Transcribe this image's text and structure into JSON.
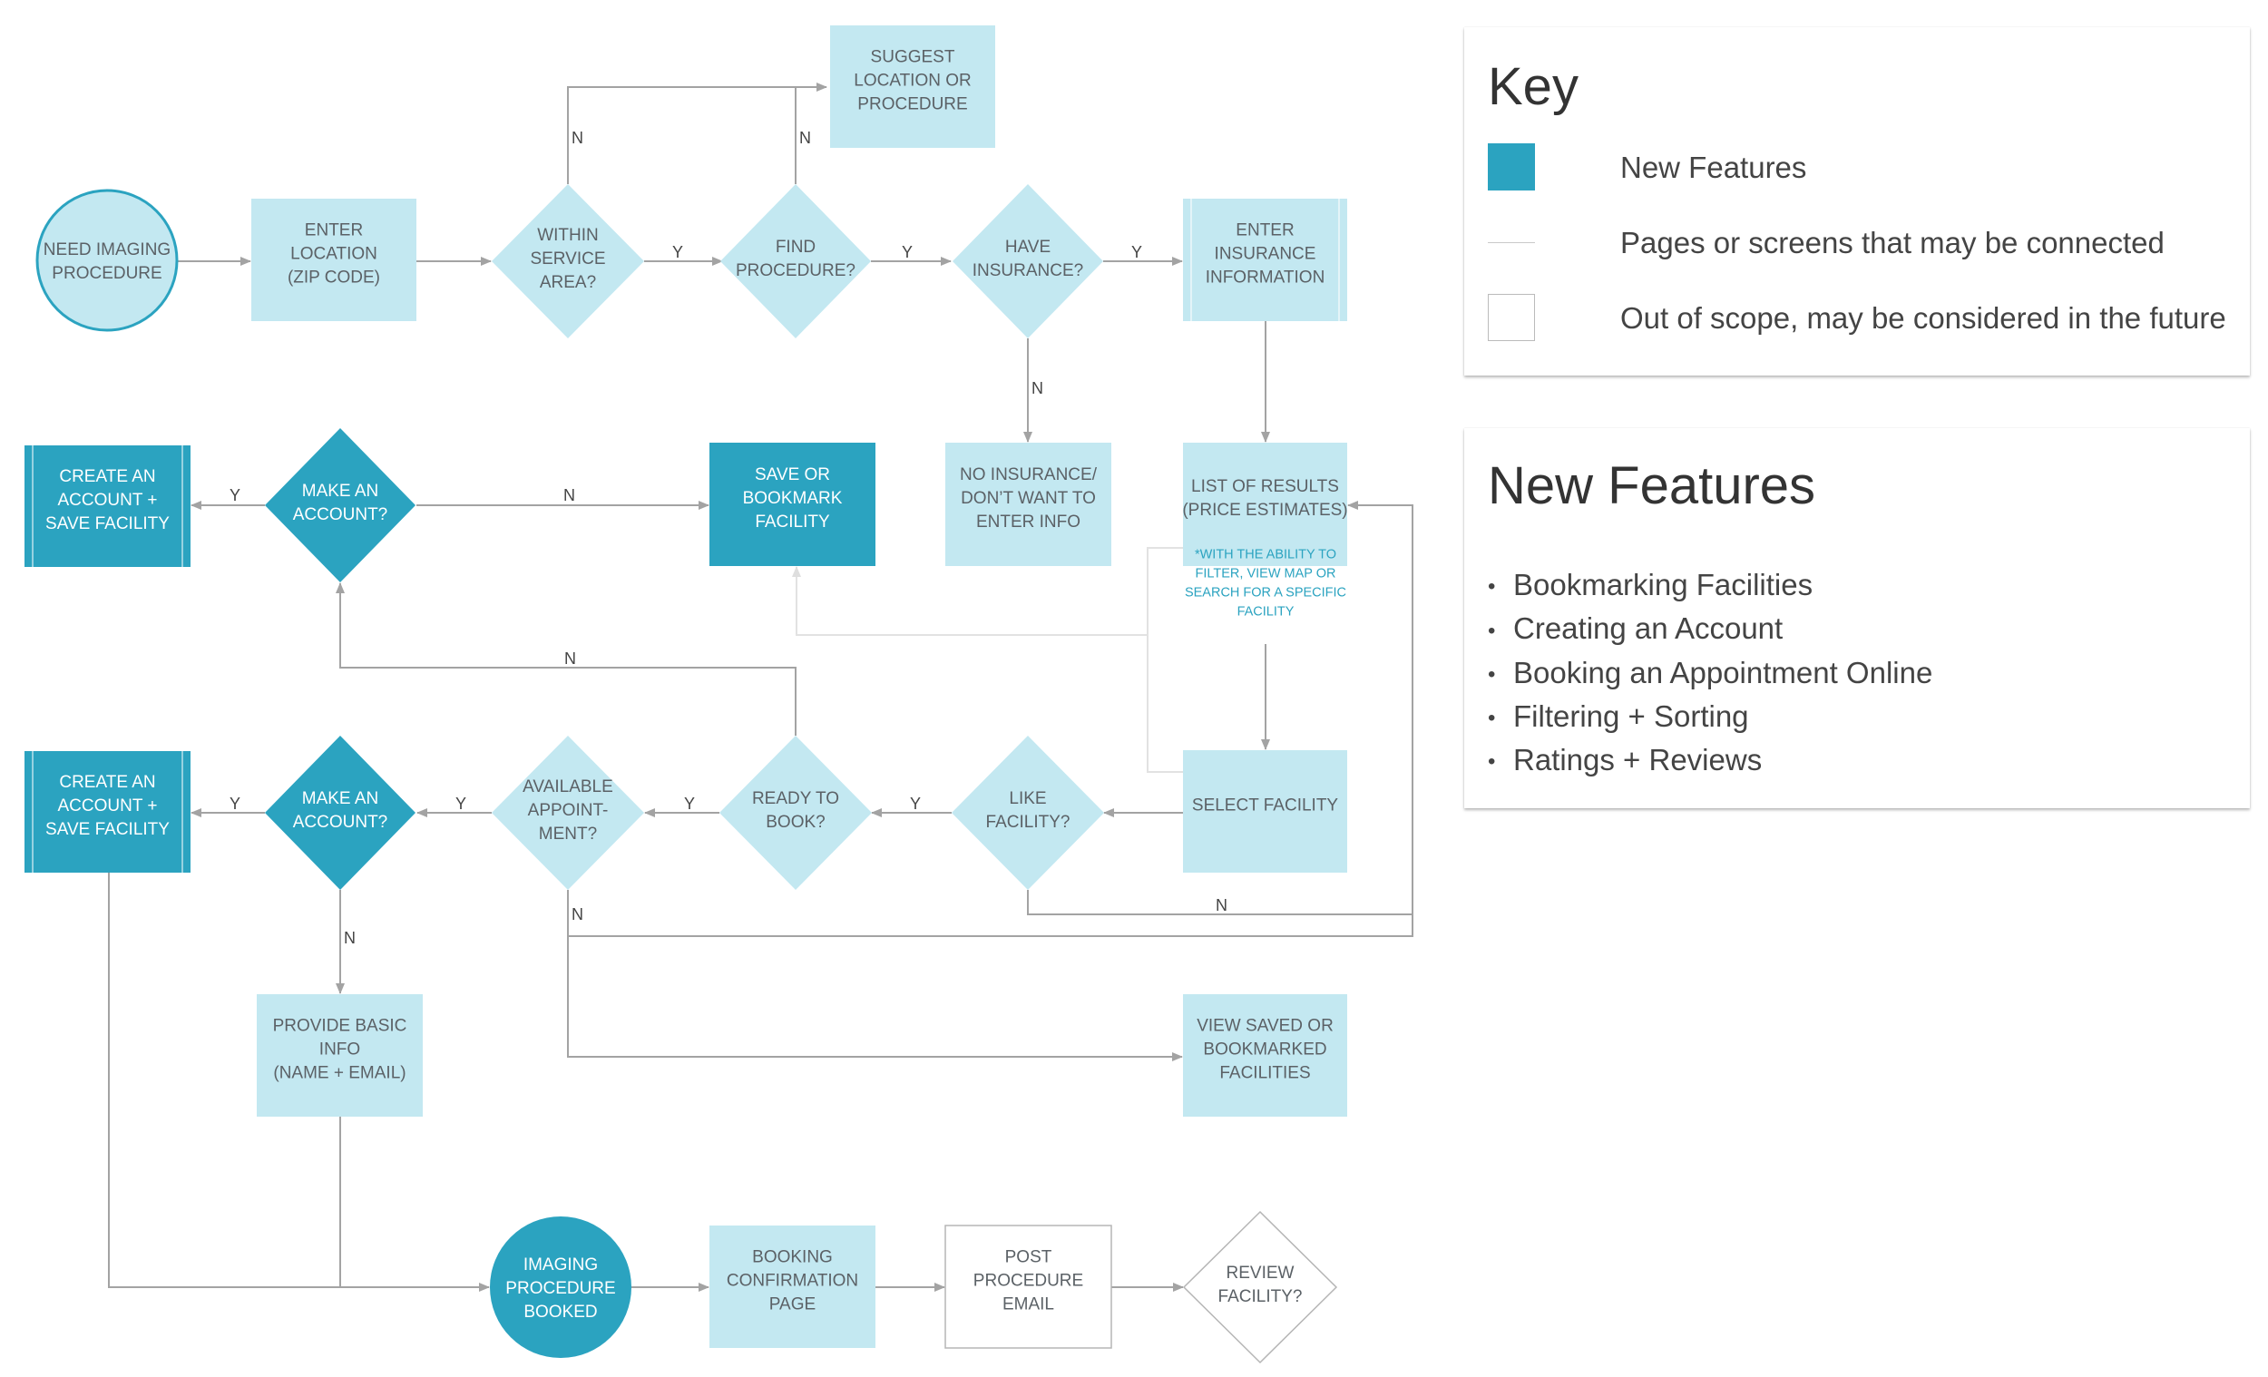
{
  "colors": {
    "new_feature": "#2ba3c0",
    "existing": "#c3e8f1",
    "out_of_scope": "#ffffff",
    "connector": "#a3a3a3",
    "possible_connector": "#e2e2e2",
    "note": "#2ba3c0"
  },
  "flow": {
    "nodes": {
      "need_imaging": [
        "NEED IMAGING",
        "PROCEDURE"
      ],
      "enter_location": [
        "ENTER",
        "LOCATION",
        "(ZIP CODE)"
      ],
      "within_service": [
        "WITHIN",
        "SERVICE",
        "AREA?"
      ],
      "find_procedure": [
        "FIND",
        "PROCEDURE?"
      ],
      "have_insurance": [
        "HAVE",
        "INSURANCE?"
      ],
      "enter_insurance": [
        "ENTER",
        "INSURANCE",
        "INFORMATION"
      ],
      "suggest": [
        "SUGGEST",
        "LOCATION OR",
        "PROCEDURE"
      ],
      "create_account_1": [
        "CREATE AN",
        "ACCOUNT +",
        "SAVE FACILITY"
      ],
      "make_account_1": [
        "MAKE AN",
        "ACCOUNT?"
      ],
      "save_bookmark": [
        "SAVE OR",
        "BOOKMARK",
        "FACILITY"
      ],
      "no_insurance": [
        "NO INSURANCE/",
        "DON’T WANT TO",
        "ENTER INFO"
      ],
      "list_results": [
        "LIST OF RESULTS",
        "(PRICE ESTIMATES)"
      ],
      "list_results_note": [
        "*WITH THE ABILITY TO",
        "FILTER, VIEW MAP OR",
        "SEARCH FOR A SPECIFIC",
        "FACILITY"
      ],
      "create_account_2": [
        "CREATE AN",
        "ACCOUNT +",
        "SAVE FACILITY"
      ],
      "make_account_2": [
        "MAKE AN",
        "ACCOUNT?"
      ],
      "available_appointment": [
        "AVAILABLE",
        "APPOINT-",
        "MENT?"
      ],
      "ready_to_book": [
        "READY TO",
        "BOOK?"
      ],
      "like_facility": [
        "LIKE",
        "FACILITY?"
      ],
      "select_facility": [
        "SELECT FACILITY"
      ],
      "provide_info": [
        "PROVIDE BASIC",
        "INFO",
        "(NAME + EMAIL)"
      ],
      "view_saved": [
        "VIEW SAVED OR",
        "BOOKMARKED",
        "FACILITIES"
      ],
      "procedure_booked": [
        "IMAGING",
        "PROCEDURE",
        "BOOKED"
      ],
      "booking_confirmation": [
        "BOOKING",
        "CONFIRMATION",
        "PAGE"
      ],
      "post_procedure_email": [
        "POST",
        "PROCEDURE",
        "EMAIL"
      ],
      "review_facility": [
        "REVIEW",
        "FACILITY?"
      ]
    },
    "labels": {
      "yes": "Y",
      "no": "N"
    }
  },
  "key": {
    "title": "Key",
    "items": [
      {
        "swatch": "filled",
        "label": "New Features"
      },
      {
        "swatch": "line",
        "label": "Pages or screens that may be connected"
      },
      {
        "swatch": "outline",
        "label": "Out of scope, may be considered in the future"
      }
    ]
  },
  "features": {
    "title": "New Features",
    "bullet": "•",
    "items": [
      "Bookmarking Facilities",
      "Creating an Account",
      "Booking an Appointment Online",
      "Filtering + Sorting",
      "Ratings + Reviews"
    ]
  }
}
